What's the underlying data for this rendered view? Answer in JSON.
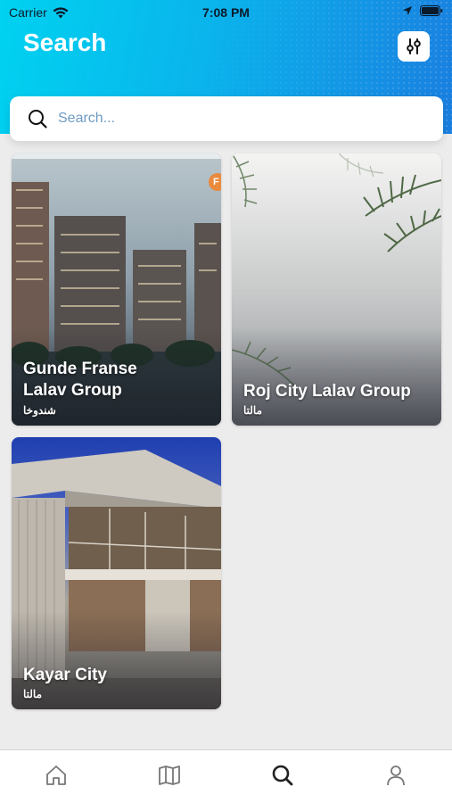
{
  "status_bar": {
    "carrier": "Carrier",
    "time": "7:08 PM"
  },
  "header": {
    "title": "Search"
  },
  "search": {
    "placeholder": "Search..."
  },
  "projects": [
    {
      "title_line1": "Gunde Franse",
      "title_line2": "Lalav Group",
      "location": "شندوخا"
    },
    {
      "title": "Roj City Lalav Group",
      "location": "مالتا"
    },
    {
      "title": "Kayar City",
      "location": "مالتا"
    }
  ],
  "badge_letter": "F",
  "tabs": [
    "home",
    "map",
    "search",
    "profile"
  ],
  "colors": {
    "accent": "#0ab4ec",
    "tab_icon": "#777777",
    "tab_active": "#222222"
  }
}
